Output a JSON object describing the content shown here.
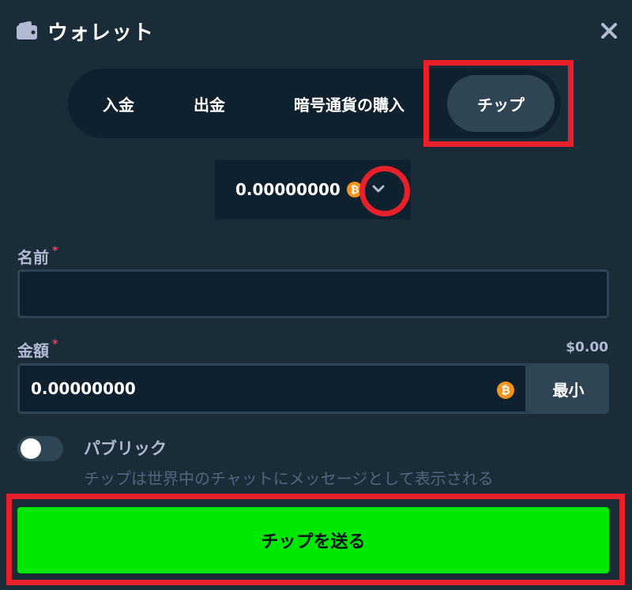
{
  "header": {
    "title": "ウォレット",
    "icon": "wallet-icon",
    "close_icon": "close-icon"
  },
  "tabs": [
    {
      "label": "入金"
    },
    {
      "label": "出金"
    },
    {
      "label": "暗号通貨の購入"
    },
    {
      "label": "チップ",
      "active": true
    }
  ],
  "currency": {
    "balance": "0.00000000",
    "icon": "bitcoin-icon",
    "dropdown_icon": "chevron-down-icon"
  },
  "form": {
    "name_label": "名前",
    "name_value": "",
    "required_mark": "*",
    "amount_label": "金額",
    "amount_usd": "$0.00",
    "amount_value": "0.00000000",
    "min_button": "最小"
  },
  "public": {
    "label": "パブリック",
    "description": "チップは世界中のチャットにメッセージとして表示される",
    "enabled": false
  },
  "send_button": "チップを送る",
  "colors": {
    "background": "#1a2c38",
    "panel": "#0f212e",
    "active_tab": "#2f4553",
    "accent_green": "#00e701",
    "highlight_red": "#e8202a",
    "bitcoin": "#f7931a"
  }
}
